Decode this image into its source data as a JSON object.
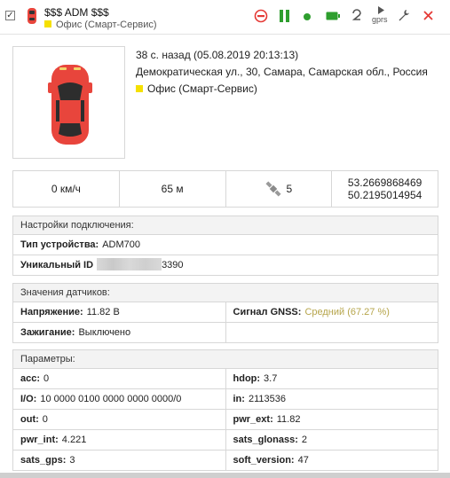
{
  "header": {
    "checkbox_mark": "✓",
    "title": "$$$ ADM $$$",
    "subtitle": "Офис (Смарт-Сервис)",
    "gprs_label": "gprs"
  },
  "colors": {
    "stop": "#e53935",
    "pause": "#2e9e2e",
    "online": "#2e9e2e",
    "battery": "#2e9e2e",
    "close": "#e53935",
    "marker": "#f5e000",
    "car": "#e8453c",
    "gnss_status": "#b6a54b"
  },
  "object": {
    "last_update": "38 с. назад (05.08.2019 20:13:13)",
    "address": "Демократическая ул., 30, Самара, Самарская обл., Россия",
    "group": "Офис (Смарт-Сервис)"
  },
  "metrics": {
    "speed": "0 км/ч",
    "altitude": "65 м",
    "satellites": "5",
    "lat": "53.2669868469",
    "lon": "50.2195014954"
  },
  "connection": {
    "header": "Настройки подключения:",
    "device_type_label": "Тип устройства:",
    "device_type_value": "ADM700",
    "id_label": "Уникальный ID",
    "id_suffix": "3390"
  },
  "sensors": {
    "header": "Значения датчиков:",
    "voltage_label": "Напряжение:",
    "voltage_value": "11.82 В",
    "gnss_label": "Сигнал GNSS:",
    "gnss_value": "Средний (67.27 %)",
    "ignition_label": "Зажигание:",
    "ignition_value": "Выключено"
  },
  "params": {
    "header": "Параметры:",
    "rows": [
      [
        {
          "k": "acc:",
          "v": "0"
        },
        {
          "k": "hdop:",
          "v": "3.7"
        }
      ],
      [
        {
          "k": "I/O:",
          "v": "10 0000 0100 0000 0000 0000/0"
        },
        {
          "k": "in:",
          "v": "2113536"
        }
      ],
      [
        {
          "k": "out:",
          "v": "0"
        },
        {
          "k": "pwr_ext:",
          "v": "11.82"
        }
      ],
      [
        {
          "k": "pwr_int:",
          "v": "4.221"
        },
        {
          "k": "sats_glonass:",
          "v": "2"
        }
      ],
      [
        {
          "k": "sats_gps:",
          "v": "3"
        },
        {
          "k": "soft_version:",
          "v": "47"
        }
      ]
    ]
  }
}
